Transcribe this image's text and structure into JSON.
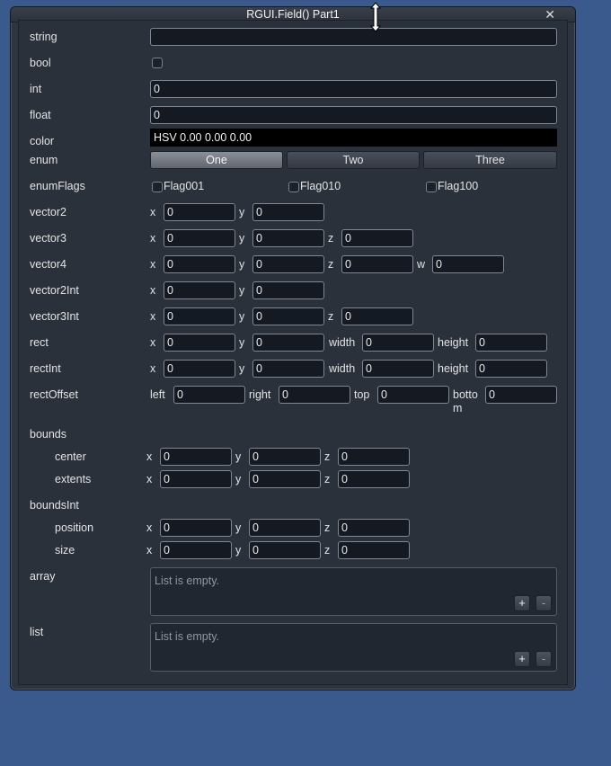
{
  "window": {
    "title": "RGUI.Field() Part1",
    "close_glyph": "✕"
  },
  "fields": {
    "string": {
      "label": "string",
      "value": ""
    },
    "bool": {
      "label": "bool",
      "checked": false
    },
    "int": {
      "label": "int",
      "value": "0"
    },
    "float": {
      "label": "float",
      "value": "0"
    },
    "color": {
      "label": "color",
      "value": "HSV 0.00 0.00 0.00"
    },
    "enum": {
      "label": "enum",
      "options": [
        "One",
        "Two",
        "Three"
      ],
      "selected": "One"
    },
    "enumFlags": {
      "label": "enumFlags",
      "flags": [
        "Flag001",
        "Flag010",
        "Flag100"
      ]
    },
    "vector2": {
      "label": "vector2",
      "x": "0",
      "y": "0"
    },
    "vector3": {
      "label": "vector3",
      "x": "0",
      "y": "0",
      "z": "0"
    },
    "vector4": {
      "label": "vector4",
      "x": "0",
      "y": "0",
      "z": "0",
      "w": "0"
    },
    "vector2Int": {
      "label": "vector2Int",
      "x": "0",
      "y": "0"
    },
    "vector3Int": {
      "label": "vector3Int",
      "x": "0",
      "y": "0",
      "z": "0"
    },
    "rect": {
      "label": "rect",
      "x": "0",
      "y": "0",
      "width": "0",
      "height": "0"
    },
    "rectInt": {
      "label": "rectInt",
      "x": "0",
      "y": "0",
      "width": "0",
      "height": "0"
    },
    "rectOffset": {
      "label": "rectOffset",
      "left": "0",
      "right": "0",
      "top": "0",
      "bottom": "0"
    },
    "bounds": {
      "label": "bounds",
      "center": {
        "label": "center",
        "x": "0",
        "y": "0",
        "z": "0"
      },
      "extents": {
        "label": "extents",
        "x": "0",
        "y": "0",
        "z": "0"
      }
    },
    "boundsInt": {
      "label": "boundsInt",
      "position": {
        "label": "position",
        "x": "0",
        "y": "0",
        "z": "0"
      },
      "size": {
        "label": "size",
        "x": "0",
        "y": "0",
        "z": "0"
      }
    },
    "array": {
      "label": "array",
      "empty_text": "List is empty.",
      "add": "+",
      "remove": "-"
    },
    "list": {
      "label": "list",
      "empty_text": "List is empty.",
      "add": "+",
      "remove": "-"
    }
  },
  "sub_labels": {
    "x": "x",
    "y": "y",
    "z": "z",
    "w": "w",
    "width": "width",
    "height": "height",
    "left": "left",
    "right": "right",
    "top": "top",
    "bottom_1": "botto",
    "bottom_2": "m"
  },
  "colors": {
    "background": "#3a5a8e",
    "window": "#2f3540",
    "field_bg": "#151a22",
    "selected_button": "#7a7f88"
  }
}
